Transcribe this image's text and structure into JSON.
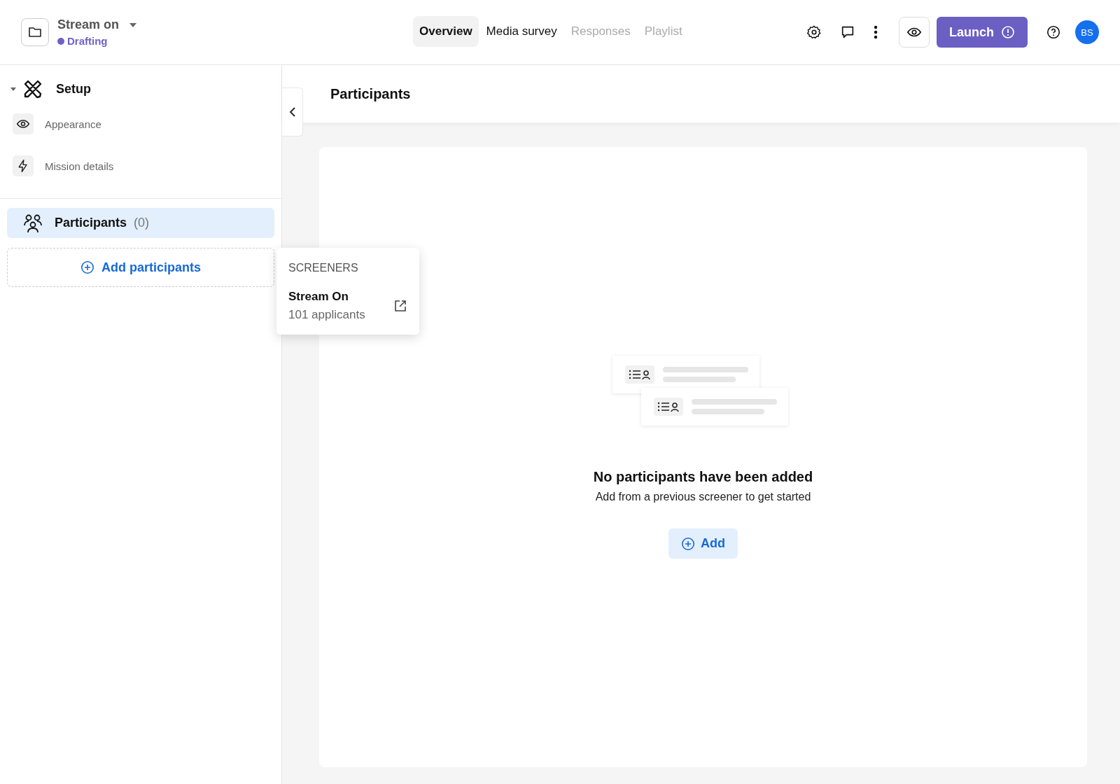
{
  "project": {
    "title": "Stream on",
    "status": {
      "label": "Drafting",
      "color": "#6e62c9"
    }
  },
  "tabs": [
    {
      "label": "Overview",
      "selected": true,
      "disabled": false
    },
    {
      "label": "Media survey",
      "selected": false,
      "disabled": false
    },
    {
      "label": "Responses",
      "selected": false,
      "disabled": true
    },
    {
      "label": "Playlist",
      "selected": false,
      "disabled": true
    }
  ],
  "launch": {
    "label": "Launch"
  },
  "avatar": {
    "initials": "BS"
  },
  "sidebar": {
    "section": {
      "label": "Setup",
      "expanded": true,
      "items": [
        {
          "label": "Appearance",
          "kind": "eye"
        },
        {
          "label": "Mission details",
          "kind": "bolt"
        }
      ]
    },
    "participants": {
      "label": "Participants",
      "count": "(0)",
      "selected": true
    },
    "add_button": "Add participants"
  },
  "popup": {
    "heading": "SCREENERS",
    "items": [
      {
        "title": "Stream On",
        "subtitle": "101 applicants"
      }
    ]
  },
  "main": {
    "title": "Participants",
    "empty_title": "No participants have been added",
    "empty_text": "Add from a previous screener to get started",
    "add_button": "Add"
  }
}
